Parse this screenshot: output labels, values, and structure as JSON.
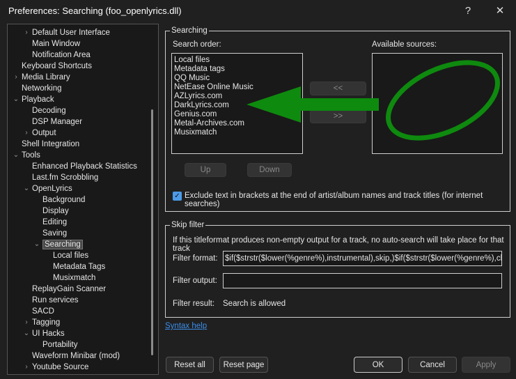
{
  "window": {
    "title": "Preferences: Searching (foo_openlyrics.dll)",
    "help": "?",
    "close": "✕"
  },
  "tree": [
    {
      "label": "Default User Interface",
      "level": 2,
      "exp": ">"
    },
    {
      "label": "Main Window",
      "level": 2
    },
    {
      "label": "Notification Area",
      "level": 2
    },
    {
      "label": "Keyboard Shortcuts",
      "level": 1
    },
    {
      "label": "Media Library",
      "level": 1,
      "exp": ">"
    },
    {
      "label": "Networking",
      "level": 1
    },
    {
      "label": "Playback",
      "level": 1,
      "exp": "v"
    },
    {
      "label": "Decoding",
      "level": 2
    },
    {
      "label": "DSP Manager",
      "level": 2
    },
    {
      "label": "Output",
      "level": 2,
      "exp": ">"
    },
    {
      "label": "Shell Integration",
      "level": 1
    },
    {
      "label": "Tools",
      "level": 1,
      "exp": "v"
    },
    {
      "label": "Enhanced Playback Statistics",
      "level": 2
    },
    {
      "label": "Last.fm Scrobbling",
      "level": 2
    },
    {
      "label": "OpenLyrics",
      "level": 2,
      "exp": "v"
    },
    {
      "label": "Background",
      "level": 3
    },
    {
      "label": "Display",
      "level": 3
    },
    {
      "label": "Editing",
      "level": 3
    },
    {
      "label": "Saving",
      "level": 3
    },
    {
      "label": "Searching",
      "level": 3,
      "exp": "v",
      "selected": true
    },
    {
      "label": "Local files",
      "level": 4
    },
    {
      "label": "Metadata Tags",
      "level": 4
    },
    {
      "label": "Musixmatch",
      "level": 4
    },
    {
      "label": "ReplayGain Scanner",
      "level": 2
    },
    {
      "label": "Run services",
      "level": 2
    },
    {
      "label": "SACD",
      "level": 2
    },
    {
      "label": "Tagging",
      "level": 2,
      "exp": ">"
    },
    {
      "label": "UI Hacks",
      "level": 2,
      "exp": "v"
    },
    {
      "label": "Portability",
      "level": 3
    },
    {
      "label": "Waveform Minibar (mod)",
      "level": 2
    },
    {
      "label": "Youtube Source",
      "level": 2,
      "exp": ">"
    }
  ],
  "searching": {
    "group_label": "Searching",
    "search_order_label": "Search order:",
    "available_label": "Available sources:",
    "search_order": [
      "Local files",
      "Metadata tags",
      "QQ Music",
      "NetEase Online Music",
      "AZLyrics.com",
      "DarkLyrics.com",
      "Genius.com",
      "Metal-Archives.com",
      "Musixmatch"
    ],
    "move_left": "<<",
    "move_right": ">>",
    "up": "Up",
    "down": "Down",
    "exclude_checkbox": "Exclude text in brackets at the end of artist/album names and track titles (for internet searches)",
    "exclude_checked": true
  },
  "skip": {
    "group_label": "Skip filter",
    "description": "If this titleformat produces non-empty output for a track, no auto-search will take place for that track",
    "format_label": "Filter format:",
    "format_value": "$if($strstr($lower(%genre%),instrumental),skip,)$if($strstr($lower(%genre%),classical),skip,)",
    "output_label": "Filter output:",
    "output_value": "",
    "result_label": "Filter result:",
    "result_value": "Search is allowed",
    "syntax_help": "Syntax help"
  },
  "footer": {
    "reset_all": "Reset all",
    "reset_page": "Reset page",
    "ok": "OK",
    "cancel": "Cancel",
    "apply": "Apply"
  },
  "annotation_color": "#0e8a0e",
  "accent": "#3b8eea"
}
